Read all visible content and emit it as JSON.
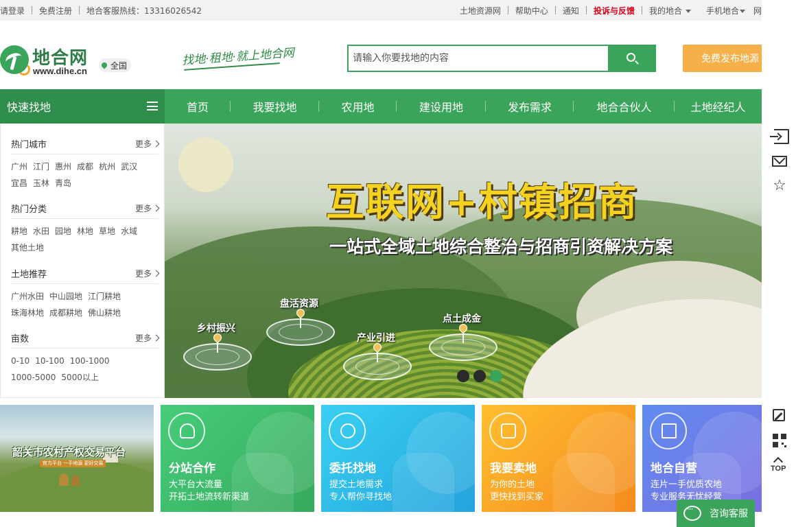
{
  "topbar": {
    "login": "请登录",
    "register": "免费注册",
    "hotline": "地合客服热线：13316026542",
    "right_links": [
      "土地资源网",
      "帮助中心",
      "通知",
      "投诉与反馈",
      "我的地合",
      "手机地合",
      "网"
    ]
  },
  "header": {
    "logo_text": "地合网",
    "logo_url": "www.dihe.cn",
    "region": "全国",
    "slogan": "找地·租地·就上地合网",
    "search_placeholder": "请输入你要找地的内容",
    "publish_button": "免费发布地源"
  },
  "nav": {
    "quick_find": "快速找地",
    "items": [
      "首页",
      "我要找地",
      "农用地",
      "建设用地",
      "发布需求",
      "地合合伙人",
      "土地经纪人"
    ]
  },
  "sidebar": {
    "more_label": "更多",
    "sections": [
      {
        "title": "热门城市",
        "items": [
          "广州",
          "江门",
          "惠州",
          "成都",
          "杭州",
          "武汉",
          "宜昌",
          "玉林",
          "青岛"
        ]
      },
      {
        "title": "热门分类",
        "items": [
          "耕地",
          "水田",
          "园地",
          "林地",
          "草地",
          "水域",
          "其他土地"
        ]
      },
      {
        "title": "土地推荐",
        "items": [
          "广州水田",
          "中山园地",
          "江门耕地",
          "珠海林地",
          "成都耕地",
          "佛山耕地"
        ]
      },
      {
        "title": "亩数",
        "items": [
          "0-10",
          "10-100",
          "100-1000",
          "1000-5000",
          "5000以上"
        ]
      }
    ]
  },
  "banner": {
    "title": "互联网+村镇招商",
    "subtitle": "一站式全域土地综合整治与招商引资解决方案",
    "markers": [
      "乡村振兴",
      "盘活资源",
      "产业引进",
      "点土成金"
    ],
    "slide_count": 3,
    "active_slide": 3
  },
  "promo": {
    "title": "韶关市农村产权交易平台",
    "tagline": "官方平台  一手地源  更好交易"
  },
  "cards": [
    {
      "title": "分站合作",
      "line1": "大平台大流量",
      "line2": "开拓土地流转新渠道",
      "color": "#3dba6e"
    },
    {
      "title": "委托找地",
      "line1": "提交土地需求",
      "line2": "专人帮你寻找地",
      "color": "#2bb2e6"
    },
    {
      "title": "我要卖地",
      "line1": "为你的土地",
      "line2": "更快找到买家",
      "color": "#f6a21e"
    },
    {
      "title": "地合自营",
      "line1": "连片一手优质农地",
      "line2": "专业服务无忧经营",
      "color": "#6f7de8"
    }
  ],
  "rightbar": {
    "top_label": "TOP"
  },
  "consult": {
    "label": "咨询客服"
  },
  "colors": {
    "brand_green": "#3aa45a",
    "dark_green": "#2f8e4c",
    "orange": "#f5b04a",
    "alert_red": "#d9001b"
  }
}
